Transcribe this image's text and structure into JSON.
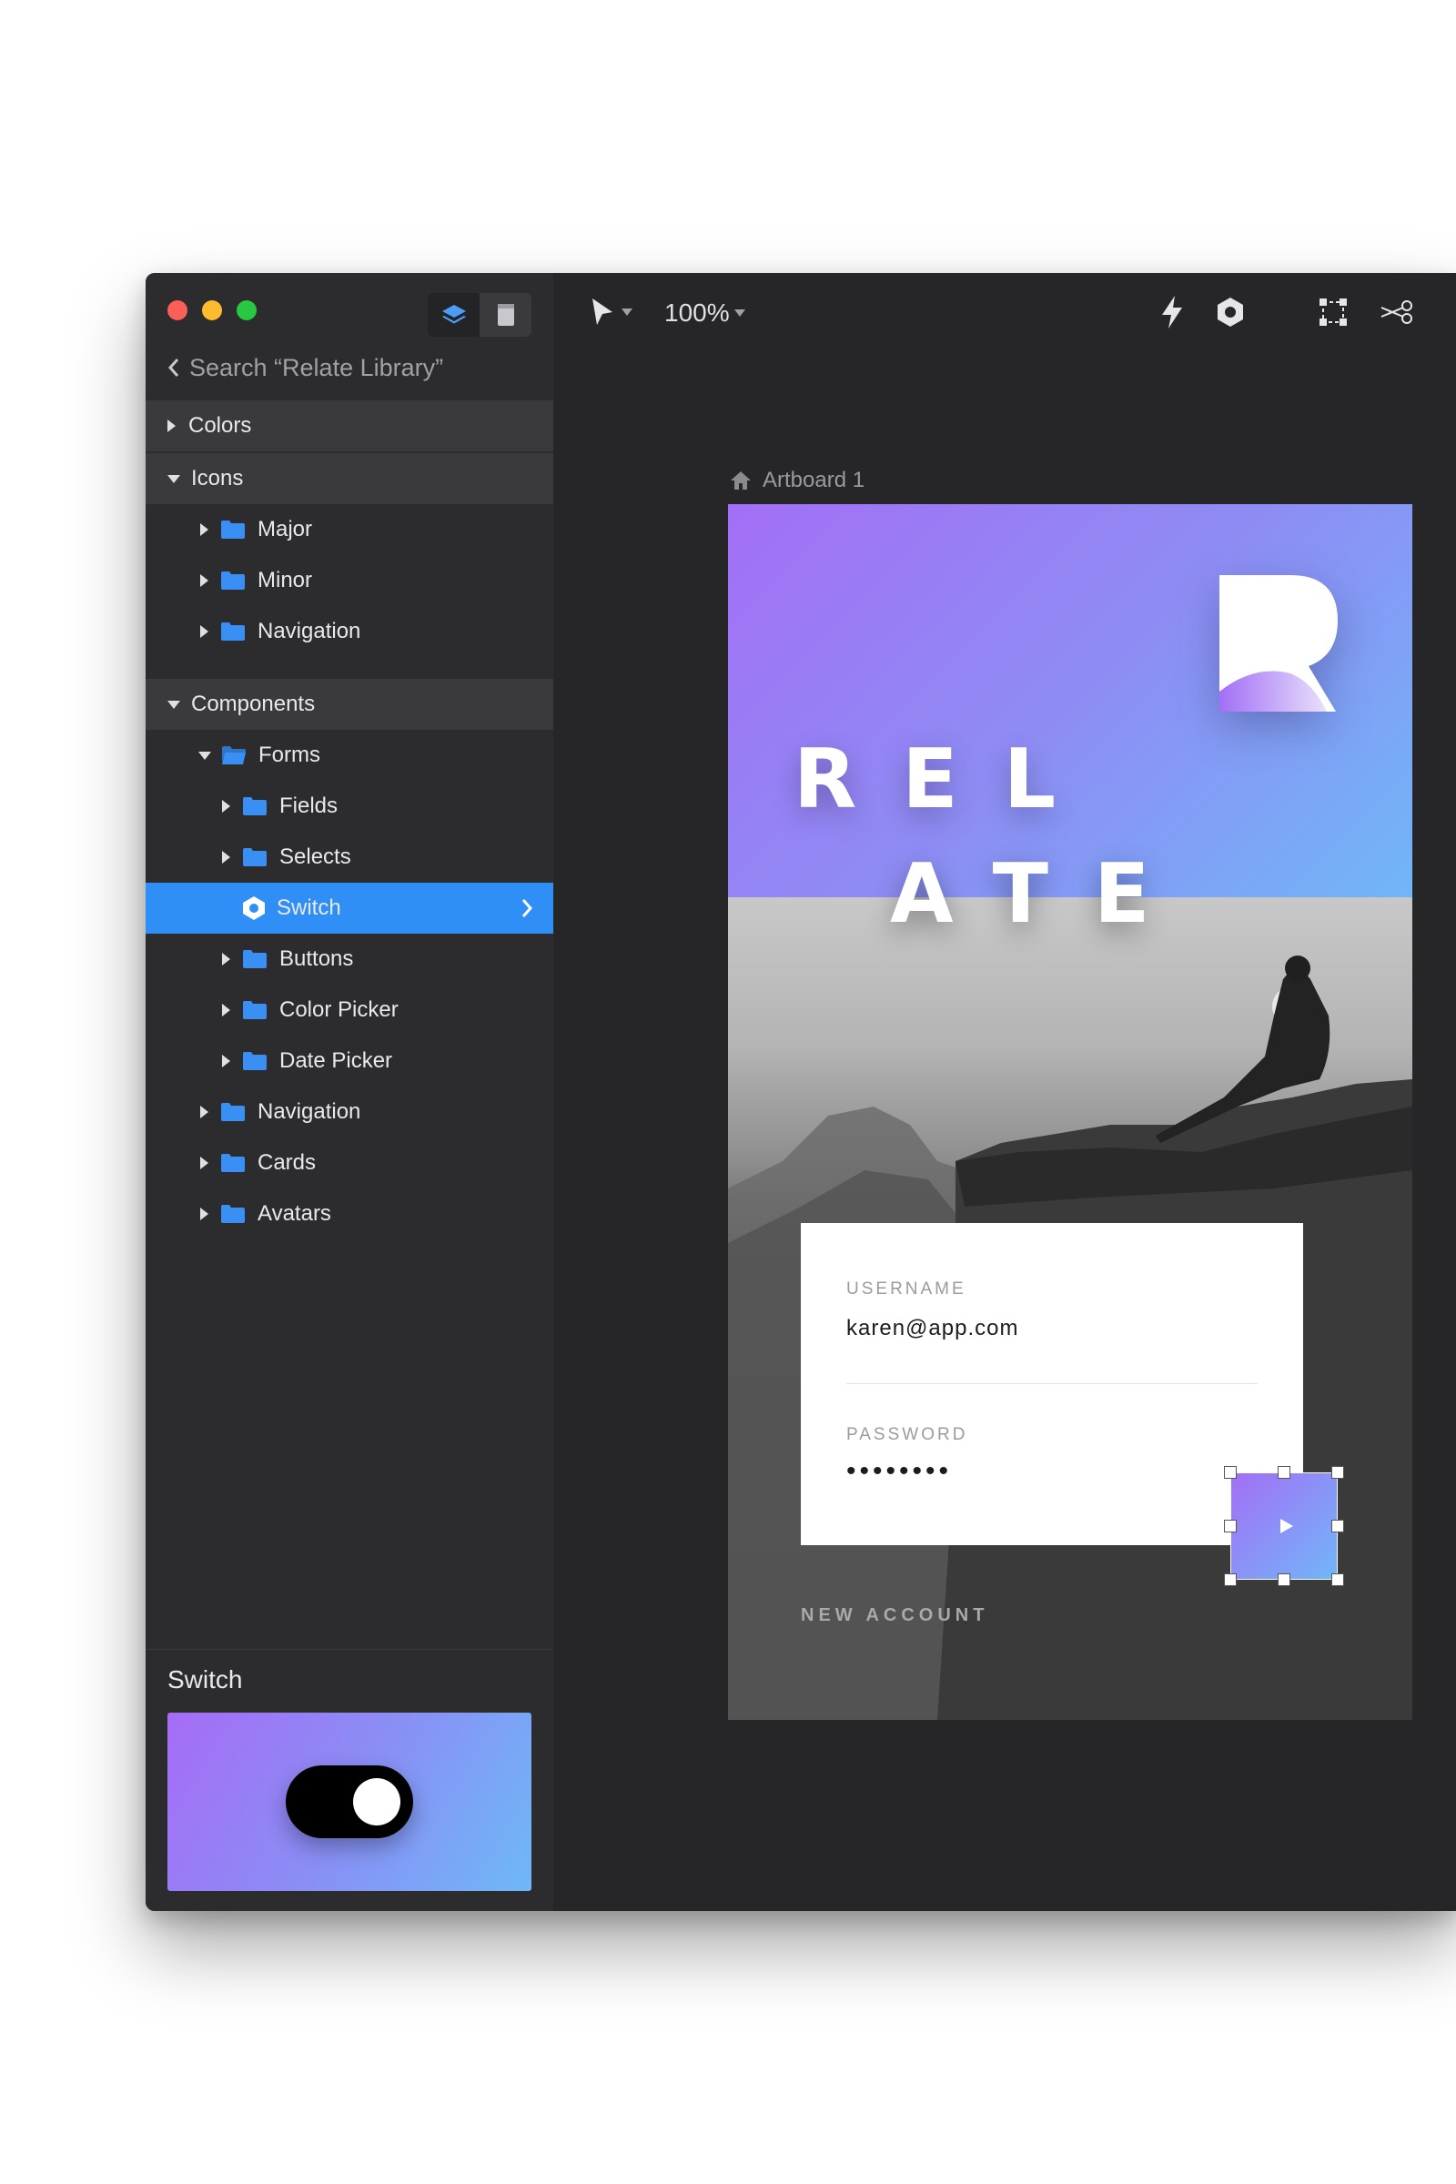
{
  "sidebar": {
    "back_label": "Search “Relate Library”",
    "tree": [
      {
        "id": "colors",
        "label": "Colors",
        "kind": "section",
        "expanded": false
      },
      {
        "id": "icons",
        "label": "Icons",
        "kind": "section",
        "expanded": true
      },
      {
        "id": "major",
        "label": "Major",
        "kind": "folder",
        "expanded": false
      },
      {
        "id": "minor",
        "label": "Minor",
        "kind": "folder",
        "expanded": false
      },
      {
        "id": "navigation1",
        "label": "Navigation",
        "kind": "folder",
        "expanded": false
      },
      {
        "id": "components",
        "label": "Components",
        "kind": "section",
        "expanded": true
      },
      {
        "id": "forms",
        "label": "Forms",
        "kind": "folder",
        "expanded": true
      },
      {
        "id": "fields",
        "label": "Fields",
        "kind": "folder",
        "expanded": false
      },
      {
        "id": "selects",
        "label": "Selects",
        "kind": "folder",
        "expanded": false
      },
      {
        "id": "switch",
        "label": "Switch",
        "kind": "component",
        "selected": true
      },
      {
        "id": "buttons",
        "label": "Buttons",
        "kind": "folder",
        "expanded": false
      },
      {
        "id": "colorpicker",
        "label": "Color Picker",
        "kind": "folder",
        "expanded": false
      },
      {
        "id": "datepicker",
        "label": "Date Picker",
        "kind": "folder",
        "expanded": false
      },
      {
        "id": "navigation2",
        "label": "Navigation",
        "kind": "folder",
        "expanded": false
      },
      {
        "id": "cards",
        "label": "Cards",
        "kind": "folder",
        "expanded": false
      },
      {
        "id": "avatars",
        "label": "Avatars",
        "kind": "folder",
        "expanded": false
      }
    ],
    "preview_title": "Switch"
  },
  "toolbar": {
    "zoom": "100%"
  },
  "artboard": {
    "label": "Artboard 1",
    "brand_line1": "REL",
    "brand_line2": "ATE",
    "username_label": "USERNAME",
    "username_value": "karen@app.com",
    "password_label": "PASSWORD",
    "password_value": "••••••••",
    "new_account": "NEW ACCOUNT"
  },
  "colors": {
    "accent": "#2f8ff7",
    "gradient_start": "#a36ff6",
    "gradient_end": "#71b6f8",
    "folder": "#3a8ff5"
  }
}
